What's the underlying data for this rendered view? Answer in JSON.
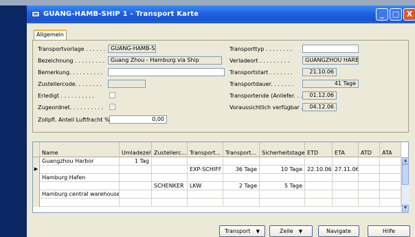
{
  "window": {
    "title": "GUANG-HAMB-SHIP 1 - Transport Karte",
    "minimize_glyph": "_",
    "maximize_glyph": "□",
    "close_glyph": "X"
  },
  "tabs": [
    {
      "label": "Allgemein"
    }
  ],
  "form": {
    "left": [
      {
        "label": "Transportvorlage . . . . . .",
        "value": "GUANG-HAMB-SHIP"
      },
      {
        "label": "Bezeichnung . . . . . . . . .",
        "value": "Guang Zhou - Hamburg via Ship"
      },
      {
        "label": "Bemerkung. . . . . . . . . .",
        "value": ""
      },
      {
        "label": "Zustellercode. . . . . . . .",
        "value": ""
      },
      {
        "label": "Erledigt . . . . . . . . . .",
        "value": ""
      },
      {
        "label": "Zugeordnet. . . . . . . . . .",
        "value": "✓"
      },
      {
        "label": "Zollpfl. Anteil Luftfracht %.",
        "value": "0,00"
      }
    ],
    "right": [
      {
        "label": "Transporttyp . . . . . . . .",
        "value": ""
      },
      {
        "label": "Verladeort . . . . . . . . .",
        "value": "GUANGZHOU HARB"
      },
      {
        "label": "Transportstart . . . . . . .",
        "value": "21.10.06"
      },
      {
        "label": "Transportdauer. . . . . . .",
        "value": "41 Tage"
      },
      {
        "label": "Transportende (Anliefer. . .",
        "value": "01.12.06"
      },
      {
        "label": "Voraussichtlich verfügbar .",
        "value": "04.12.06"
      }
    ]
  },
  "table": {
    "columns": [
      "Name",
      "Umladezeit",
      "Zustellerc...",
      "Transport...",
      "Transport...",
      "Sicherheitstage",
      "ETD",
      "ETA",
      "ATD",
      "ATA"
    ],
    "rows": [
      [
        "Guangzhou Harbor",
        "1 Tag",
        "",
        "",
        "",
        "",
        "",
        "",
        "",
        ""
      ],
      [
        "",
        "",
        "",
        "EXP-SCHIFF",
        "36 Tage",
        "10 Tage",
        "22.10.06",
        "27.11.06",
        "",
        ""
      ],
      [
        "Hamburg Hafen",
        "",
        "",
        "",
        "",
        "",
        "",
        "",
        "",
        ""
      ],
      [
        "",
        "",
        "SCHENKER",
        "LKW",
        "2 Tage",
        "5 Tage",
        "",
        "",
        "",
        ""
      ],
      [
        "Hamburg central warehouse",
        "",
        "",
        "",
        "",
        "",
        "",
        "",
        "",
        ""
      ],
      [
        "",
        "",
        "",
        "",
        "",
        "",
        "",
        "",
        "",
        ""
      ]
    ],
    "current_row_marker": "▶",
    "scroll_up_glyph": "▲",
    "scroll_down_glyph": "▼"
  },
  "buttons": {
    "transport": {
      "label": "Transport",
      "caret": "▼"
    },
    "zeile": {
      "label": "Zeile",
      "caret": "▼"
    },
    "navigate": {
      "label": "Navigate"
    },
    "hilfe": {
      "label": "Hilfe"
    }
  },
  "colors": {
    "titlebar": "#1f5fe0",
    "background": "#0a2260",
    "panel": "#ece9d8",
    "tab_accent": "#f3b63e"
  },
  "icons": [
    "app-icon",
    "minimize-icon",
    "maximize-icon",
    "close-icon",
    "chevron-down-icon",
    "scroll-up-icon",
    "scroll-down-icon"
  ]
}
